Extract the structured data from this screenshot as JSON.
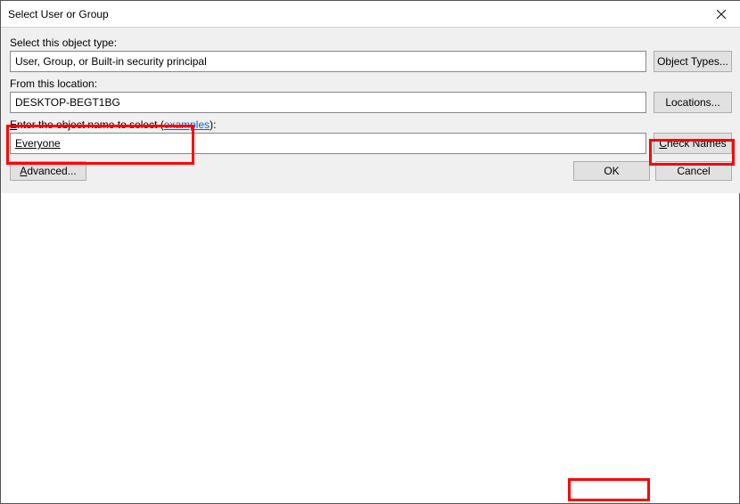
{
  "window": {
    "title": "Select User or Group"
  },
  "objectType": {
    "label": "Select this object type:",
    "value": "User, Group, or Built-in security principal",
    "button": "Object Types..."
  },
  "location": {
    "label": "From this location:",
    "value": "DESKTOP-BEGT1BG",
    "button": "Locations..."
  },
  "objectName": {
    "labelPrefix": "E",
    "labelRest": "nter the object name to select (",
    "examplesLink": "examples",
    "labelSuffix": "):",
    "value": "Everyone",
    "checkButtonPrefix": "C",
    "checkButtonRest": "heck Names"
  },
  "footer": {
    "advancedPrefix": "A",
    "advancedRest": "dvanced...",
    "ok": "OK",
    "cancel": "Cancel"
  }
}
